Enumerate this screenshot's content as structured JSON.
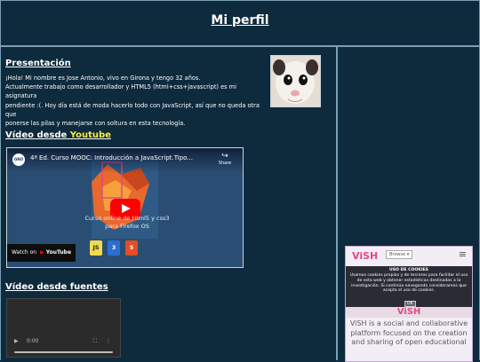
{
  "header": {
    "title": "Mi perfil"
  },
  "presentation": {
    "title": "Presentación",
    "bio_lines": [
      "¡Hola! Mi nombre es Jose Antonio, vivo en Girona y tengo 32 años.",
      "Actualmente trabajo como desarrollador y HTML5 (html+css+javascript) es mi asignatura",
      "pendiente :(. Hoy día está de moda hacerlo todo con JavaScript, así que no queda otra que",
      "ponerse las pilas y manejarse con soltura en esta tecnología."
    ]
  },
  "youtube_section": {
    "title_prefix": "Vídeo desde ",
    "title_highlight": "Youtube"
  },
  "youtube_embed": {
    "channel_badge": "GNO",
    "title": "4ª Ed. Curso MOOC: Introducción a JavaScript.Tipo...",
    "share_label": "Share",
    "subtitle_line1": "Curso online de Html5 y css3",
    "subtitle_line2": "para Firefox OS",
    "badges": [
      "JS",
      "3",
      "5"
    ],
    "watch_on": "Watch on",
    "brand": "YouTube"
  },
  "video_section": {
    "title": "Vídeo desde fuentes"
  },
  "video_player": {
    "time": "0:00"
  },
  "vish": {
    "logo": "ViSH",
    "browse_label": "Browse ▾",
    "menu_icon": "≡",
    "cookie_title": "USO DE COOKIES",
    "cookie_text": "Usamos cookies propias y de terceros para facilitar el uso de esta web y obtener estadísticas destinadas a la investigación. Si continúa navegando consideramos que acepta el uso de cookies.",
    "cookie_ok": "OK",
    "band_logo": "ViSH",
    "description": "ViSH is a social and collaborative platform focused on the creation and sharing of open educational"
  },
  "colors": {
    "page_bg": "#0e2a3d",
    "highlight": "#f6f03a",
    "border": "#7aa0b4",
    "vish_pink": "#e24886"
  }
}
